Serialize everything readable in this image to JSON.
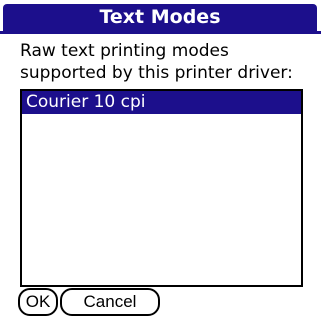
{
  "dialog": {
    "title": "Text Modes",
    "description_line1": "Raw text printing modes",
    "description_line2": "supported by this printer driver:"
  },
  "list": {
    "items": [
      {
        "label": "Courier 10 cpi",
        "selected": true
      }
    ]
  },
  "buttons": {
    "ok_label": "OK",
    "cancel_label": "Cancel"
  },
  "colors": {
    "accent": "#1c0f8c",
    "background": "#ffffff",
    "text": "#000000"
  }
}
